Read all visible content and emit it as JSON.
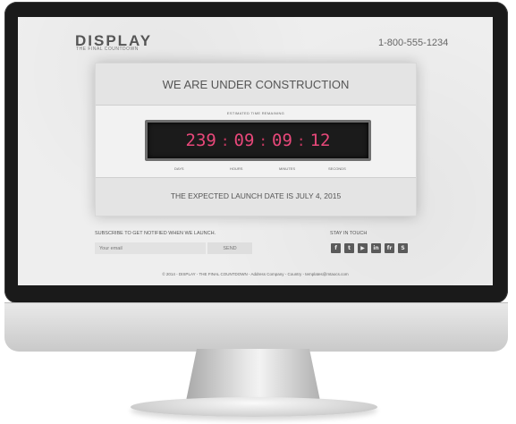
{
  "header": {
    "logo": "DISPLAY",
    "tagline": "THE FINAL COUNTDOWN",
    "phone": "1-800-555-1234"
  },
  "main": {
    "title": "WE ARE UNDER CONSTRUCTION",
    "estimated_label": "ESTIMATED TIME REMAINING",
    "countdown": {
      "days": "239",
      "hours": "09",
      "minutes": "09",
      "seconds": "12",
      "separator": ":"
    },
    "units": {
      "days": "DAYS",
      "hours": "HOURS",
      "minutes": "MINUTES",
      "seconds": "SECONDS"
    },
    "launch_text": "THE EXPECTED LAUNCH DATE IS JULY 4, 2015"
  },
  "subscribe": {
    "label": "SUBSCRIBE TO GET NOTIFIED WHEN WE LAUNCH.",
    "email_placeholder": "Your email",
    "send_label": "SEND"
  },
  "social": {
    "label": "STAY IN TOUCH",
    "icons": [
      {
        "name": "facebook-icon",
        "glyph": "f"
      },
      {
        "name": "twitter-icon",
        "glyph": "t"
      },
      {
        "name": "youtube-icon",
        "glyph": "▶"
      },
      {
        "name": "linkedin-icon",
        "glyph": "in"
      },
      {
        "name": "flickr-icon",
        "glyph": "fr"
      },
      {
        "name": "skype-icon",
        "glyph": "S"
      }
    ]
  },
  "footer": {
    "text": "© 2014 - DISPLAY - THE FINAL COUNTDOWN - Address Company - Country - templates@mtaocs.com"
  },
  "colors": {
    "countdown_digits": "#e8487a",
    "screen_bg": "#eeeeee",
    "bezel": "#1a1a1a"
  }
}
